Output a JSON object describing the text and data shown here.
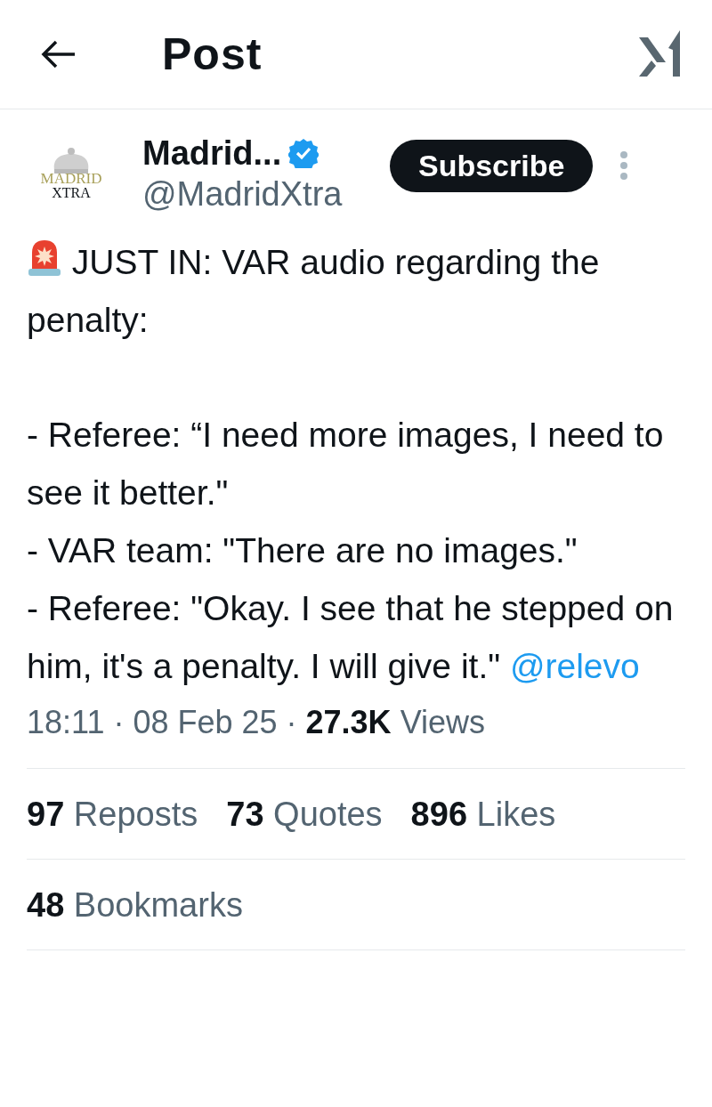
{
  "header": {
    "title": "Post"
  },
  "author": {
    "avatar_text": [
      "MADRID",
      "XTRA"
    ],
    "name": "Madrid...",
    "verified": true,
    "handle": "@MadridXtra",
    "subscribe_label": "Subscribe"
  },
  "post": {
    "text": " JUST IN: VAR audio regarding the penalty:\n\n- Referee: “I need more images, I need to see it better.\"\n- VAR team: \"There are no images.\"\n- Referee: \"Okay. I see that he stepped on him, it's a penalty. I will give it.\" ",
    "mention": "@relevo"
  },
  "meta": {
    "time": "18:11",
    "separators": [
      "·",
      "·"
    ],
    "date": "08 Feb 25",
    "views_count": "27.3K",
    "views_label": "Views"
  },
  "stats": [
    {
      "count": "97",
      "label": "Reposts"
    },
    {
      "count": "73",
      "label": "Quotes"
    },
    {
      "count": "896",
      "label": "Likes"
    }
  ],
  "bookmarks": {
    "count": "48",
    "label": "Bookmarks"
  }
}
